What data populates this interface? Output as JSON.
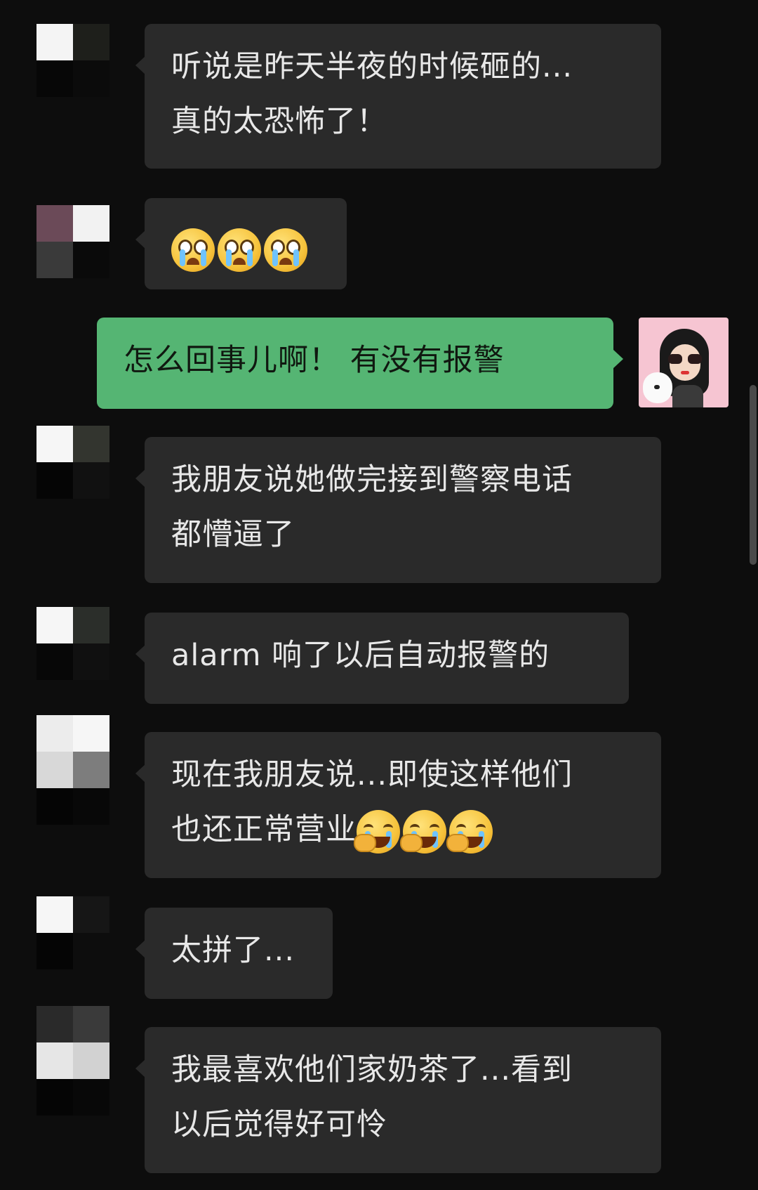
{
  "messages": [
    {
      "side": "left",
      "lines": [
        "听说是昨天半夜的时候砸的...",
        "真的太恐怖了！"
      ]
    },
    {
      "side": "left",
      "emoji": [
        "crying-face-emoji",
        "crying-face-emoji",
        "crying-face-emoji"
      ]
    },
    {
      "side": "right",
      "lines": [
        "怎么回事儿啊！ 有没有报警"
      ]
    },
    {
      "side": "left",
      "lines": [
        "我朋友说她做完接到警察电话",
        "都懵逼了"
      ]
    },
    {
      "side": "left",
      "lines": [
        "alarm 响了以后自动报警的"
      ]
    },
    {
      "side": "left",
      "lines": [
        "现在我朋友说...即使这样他们",
        "也还正常营业"
      ],
      "emoji": [
        "laughing-crying-emoji",
        "laughing-crying-emoji",
        "laughing-crying-emoji"
      ]
    },
    {
      "side": "left",
      "lines": [
        "太拼了..."
      ]
    },
    {
      "side": "left",
      "lines": [
        "我最喜欢他们家奶茶了...看到",
        "以后觉得好可怜"
      ]
    }
  ],
  "colors": {
    "background": "#0d0d0d",
    "incoming_bubble": "#2a2a2a",
    "outgoing_bubble": "#55b573",
    "incoming_text": "#e8e8e8",
    "outgoing_text": "#101810"
  },
  "avatars": {
    "left": "pixelated-avatar",
    "right": "woman-with-sunglasses-and-dog-avatar"
  }
}
